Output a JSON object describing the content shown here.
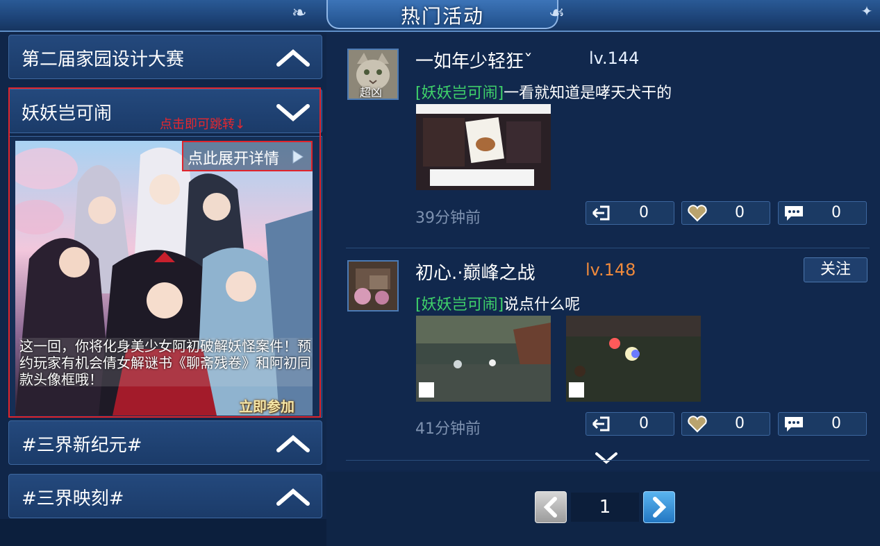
{
  "window": {
    "title": "热门活动"
  },
  "events": [
    {
      "label": "第二届家园设计大赛",
      "state": "collapsed"
    },
    {
      "label": "妖妖岂可闹",
      "state": "expanded"
    },
    {
      "label": "#三界新纪元#",
      "state": "collapsed"
    },
    {
      "label": "#三界映刻#",
      "state": "collapsed"
    }
  ],
  "expanded": {
    "hint": "点击即可跳转↓",
    "detail_label": "点此展开详情",
    "description": "这一回，你将化身美少女阿初破解妖怪案件！预约玩家有机会倩女解谜书《聊斋残卷》和阿初同款头像框哦！",
    "join_label": "立即参加"
  },
  "posts": [
    {
      "avatar_caption": "超凶",
      "username": "一如年少轻狂ˇ",
      "level": "lv.144",
      "level_color": "#e6f0ff",
      "tag": "[妖妖岂可闹]",
      "text": "一看就知道是哮天犬干的",
      "time": "39分钟前",
      "share_count": "0",
      "like_count": "0",
      "comment_count": "0"
    },
    {
      "username": "初心.·巅峰之战",
      "level": "lv.148",
      "level_color": "#f08a3c",
      "follow_label": "关注",
      "tag": "[妖妖岂可闹]",
      "text": "说点什么呢",
      "time": "41分钟前",
      "share_count": "0",
      "like_count": "0",
      "comment_count": "0"
    }
  ],
  "pager": {
    "current": "1"
  },
  "colors": {
    "accent_green": "#3fd26a",
    "highlight_red": "#e0242b",
    "panel": "#1b3b69"
  }
}
